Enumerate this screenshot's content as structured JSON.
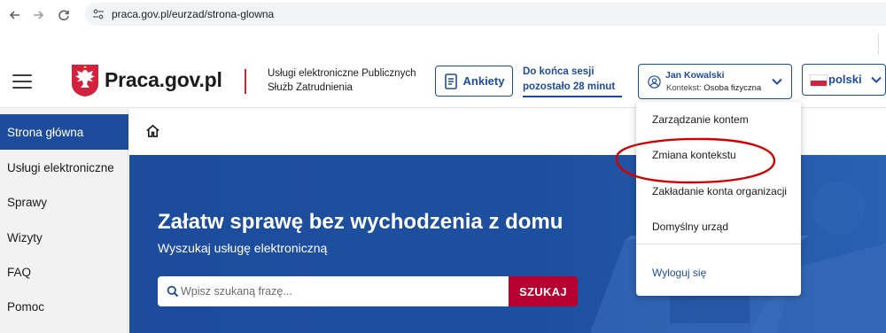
{
  "browser": {
    "url": "praca.gov.pl/eurzad/strona-glowna"
  },
  "header": {
    "logo_text": "Praca.gov.pl",
    "service_line1": "Usługi elektroniczne Publicznych",
    "service_line2": "Służb Zatrudnienia",
    "surveys_label": "Ankiety",
    "session_line1": "Do końca sesji",
    "session_line2": "pozostało 28 minut",
    "user_name": "Jan Kowalski",
    "context_label": "Kontekst:",
    "context_value": "Osoba fizyczna",
    "language": "polski"
  },
  "sidebar": {
    "items": [
      {
        "label": "Strona główna",
        "active": true
      },
      {
        "label": "Usługi elektroniczne"
      },
      {
        "label": "Sprawy"
      },
      {
        "label": "Wizyty"
      },
      {
        "label": "FAQ"
      },
      {
        "label": "Pomoc"
      }
    ]
  },
  "hero": {
    "title": "Załatw sprawę bez wychodzenia z domu",
    "subtitle": "Wyszukaj usługę elektroniczną",
    "search_placeholder": "Wpisz szukaną frazę...",
    "search_button": "SZUKAJ"
  },
  "user_menu": {
    "items": [
      {
        "label": "Zarządzanie kontem"
      },
      {
        "label": "Zmiana kontekstu"
      },
      {
        "label": "Zakładanie konta organizacji"
      },
      {
        "label": "Domyślny urząd"
      }
    ],
    "logout": "Wyloguj się"
  },
  "colors": {
    "primary": "#1d4c9c",
    "accent_red": "#b7002f",
    "annotation": "#d40000"
  }
}
